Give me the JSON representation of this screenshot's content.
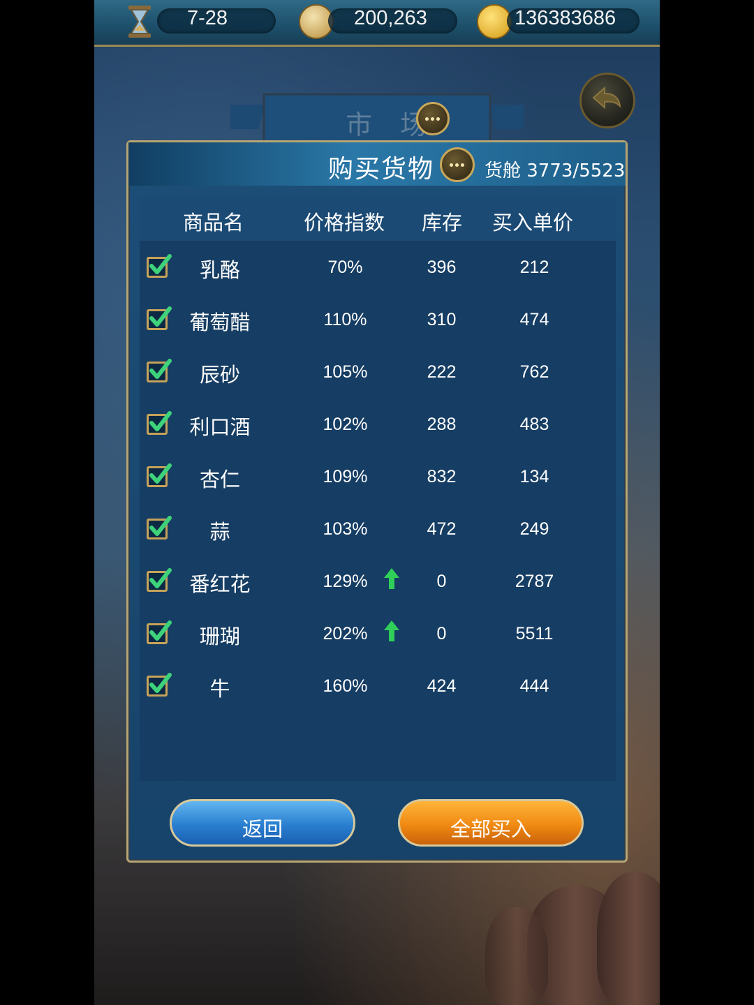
{
  "topbar": {
    "date": "7-28",
    "compass_value": "200,263",
    "gold": "136383686"
  },
  "market": {
    "title": "市 场"
  },
  "panel": {
    "title": "购买货物",
    "cargo": "货舱 3773/5523"
  },
  "table": {
    "headers": {
      "name": "商品名",
      "price_index": "价格指数",
      "stock": "库存",
      "unit_price": "买入单价"
    },
    "rows": [
      {
        "name": "乳酪",
        "price_index": "70%",
        "stock": "396",
        "unit_price": "212",
        "checked": true,
        "rising": false
      },
      {
        "name": "葡萄醋",
        "price_index": "110%",
        "stock": "310",
        "unit_price": "474",
        "checked": true,
        "rising": false
      },
      {
        "name": "辰砂",
        "price_index": "105%",
        "stock": "222",
        "unit_price": "762",
        "checked": true,
        "rising": false
      },
      {
        "name": "利口酒",
        "price_index": "102%",
        "stock": "288",
        "unit_price": "483",
        "checked": true,
        "rising": false
      },
      {
        "name": "杏仁",
        "price_index": "109%",
        "stock": "832",
        "unit_price": "134",
        "checked": true,
        "rising": false
      },
      {
        "name": "蒜",
        "price_index": "103%",
        "stock": "472",
        "unit_price": "249",
        "checked": true,
        "rising": false
      },
      {
        "name": "番红花",
        "price_index": "129%",
        "stock": "0",
        "unit_price": "2787",
        "checked": true,
        "rising": true
      },
      {
        "name": "珊瑚",
        "price_index": "202%",
        "stock": "0",
        "unit_price": "5511",
        "checked": true,
        "rising": true
      },
      {
        "name": "牛",
        "price_index": "160%",
        "stock": "424",
        "unit_price": "444",
        "checked": true,
        "rising": false
      }
    ]
  },
  "buttons": {
    "back": "返回",
    "buy_all": "全部买入"
  },
  "colors": {
    "accent_gold": "#c6a35a",
    "check_green": "#3ed27a",
    "arrow_green": "#2fcf5a"
  },
  "icons": [
    "hourglass-icon",
    "compass-icon",
    "gold-coin-icon",
    "return-arrow-icon",
    "chat-bubble-icon",
    "checkmark-icon",
    "up-arrow-icon"
  ]
}
